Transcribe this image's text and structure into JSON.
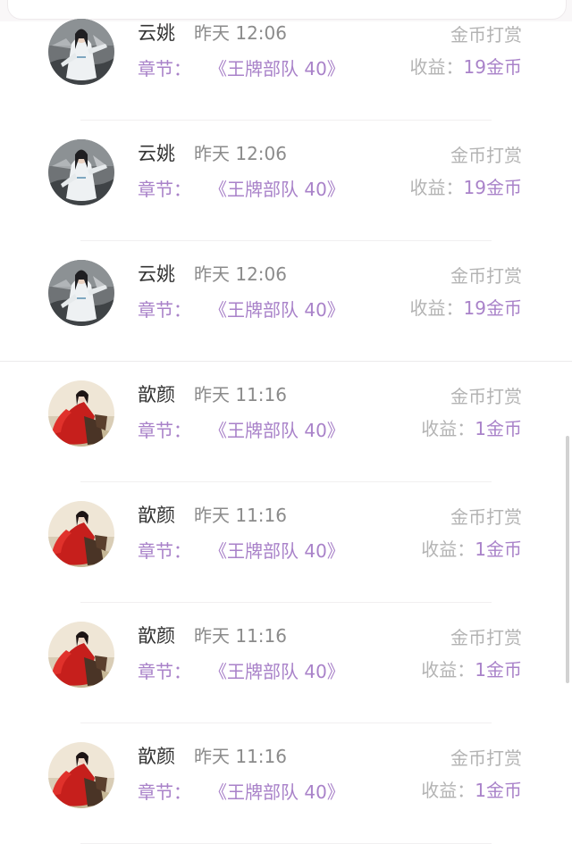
{
  "records": [
    {
      "name": "云姚",
      "time": "昨天 12:06",
      "chapter_label": "章节：",
      "chapter_title": "《王牌部队 40》",
      "type": "金币打赏",
      "earn_label": "收益：",
      "earn_value": "19金币",
      "avatar": "avatar-yunyao"
    },
    {
      "name": "云姚",
      "time": "昨天 12:06",
      "chapter_label": "章节：",
      "chapter_title": "《王牌部队 40》",
      "type": "金币打赏",
      "earn_label": "收益：",
      "earn_value": "19金币",
      "avatar": "avatar-yunyao"
    },
    {
      "name": "云姚",
      "time": "昨天 12:06",
      "chapter_label": "章节：",
      "chapter_title": "《王牌部队 40》",
      "type": "金币打赏",
      "earn_label": "收益：",
      "earn_value": "19金币",
      "avatar": "avatar-yunyao"
    },
    {
      "name": "歆颜",
      "time": "昨天 11:16",
      "chapter_label": "章节：",
      "chapter_title": "《王牌部队 40》",
      "type": "金币打赏",
      "earn_label": "收益：",
      "earn_value": "1金币",
      "avatar": "avatar-xinyan"
    },
    {
      "name": "歆颜",
      "time": "昨天 11:16",
      "chapter_label": "章节：",
      "chapter_title": "《王牌部队 40》",
      "type": "金币打赏",
      "earn_label": "收益：",
      "earn_value": "1金币",
      "avatar": "avatar-xinyan"
    },
    {
      "name": "歆颜",
      "time": "昨天 11:16",
      "chapter_label": "章节：",
      "chapter_title": "《王牌部队 40》",
      "type": "金币打赏",
      "earn_label": "收益：",
      "earn_value": "1金币",
      "avatar": "avatar-xinyan"
    },
    {
      "name": "歆颜",
      "time": "昨天 11:16",
      "chapter_label": "章节：",
      "chapter_title": "《王牌部队 40》",
      "type": "金币打赏",
      "earn_label": "收益：",
      "earn_value": "1金币",
      "avatar": "avatar-xinyan"
    }
  ],
  "colors": {
    "accent": "#a982c9",
    "muted": "#b3b3b3",
    "name": "#333333",
    "time": "#8b8b8b"
  }
}
